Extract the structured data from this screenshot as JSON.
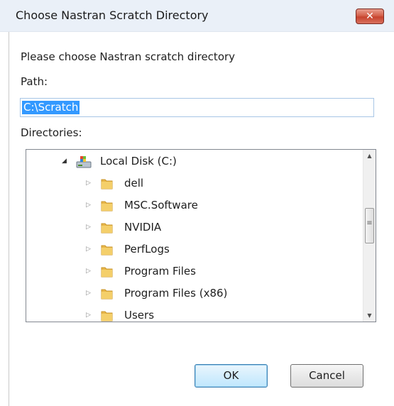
{
  "window": {
    "title": "Choose Nastran Scratch Directory",
    "close_glyph": "✕"
  },
  "prompt": "Please choose Nastran scratch directory",
  "path_label": "Path:",
  "path_value": "C:\\Scratch",
  "directories_label": "Directories:",
  "tree": {
    "root": {
      "label": "Local Disk (C:)",
      "icon": "drive-icon",
      "expanded": true
    },
    "folders": [
      "dell",
      "MSC.Software",
      "NVIDIA",
      "PerfLogs",
      "Program Files",
      "Program Files (x86)",
      "Users"
    ]
  },
  "buttons": {
    "ok": "OK",
    "cancel": "Cancel"
  },
  "colors": {
    "selection": "#3399ff",
    "folder": "#e8b74a",
    "title_bar": "#eaf0f8"
  }
}
